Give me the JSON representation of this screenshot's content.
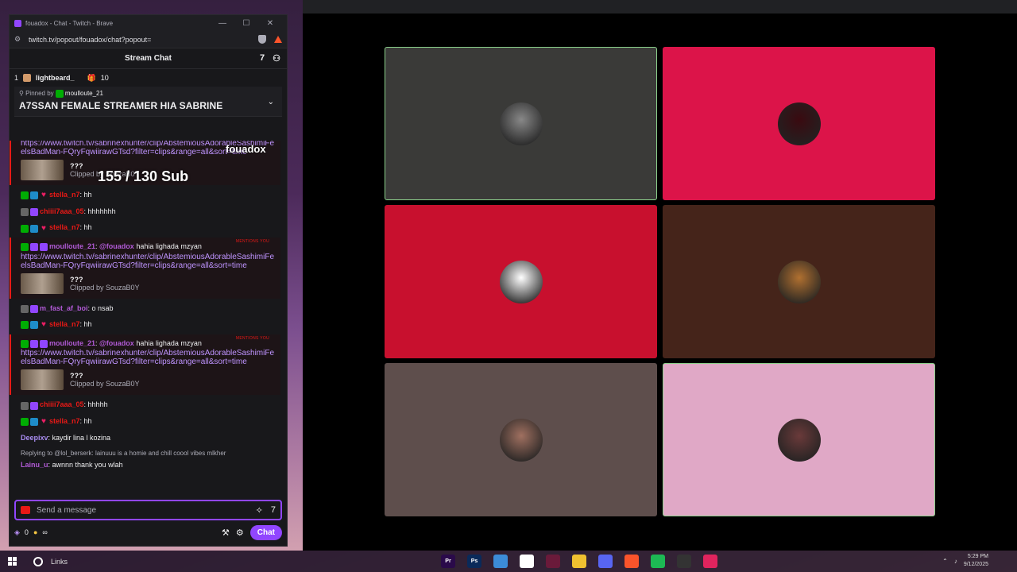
{
  "browser": {
    "title": "fouadox - Chat - Twitch - Brave",
    "url": "twitch.tv/popout/fouadox/chat?popout=",
    "controls": {
      "minimize": "—",
      "maximize": "☐",
      "close": "✕"
    }
  },
  "chat": {
    "header_title": "Stream Chat",
    "leaderboard": {
      "rank": "1",
      "user": "lightbeard_",
      "gift_count": "10"
    },
    "pinned": {
      "by_label": "Pinned by",
      "by_user": "moulloute_21",
      "message": "A7SSAN FEMALE STREAMER HIA SABRINE"
    },
    "clip_url": "https://www.twitch.tv/sabrinexhunter/clip/AbstemiousAdorableSashimiFeelsBadMan-FQryFqwiirawGTsd?filter=clips&range=all&sort=time",
    "clip_title": "???",
    "clip_by": "Clipped by SouzaB0Y",
    "mentions_tag": "MENTIONS YOU",
    "messages": [
      {
        "user": "stella_n7",
        "text": ": hh",
        "color": "#e91916"
      },
      {
        "user": "chiiii7aaa_05",
        "text": ": hhhhhhh",
        "color": "#e91916"
      },
      {
        "user": "stella_n7",
        "text": ": hh",
        "color": "#e91916"
      },
      {
        "user": "moulloute_21",
        "mention": "@fouadox",
        "text": "hahia lighada mzyan",
        "color": "#b15ad6"
      },
      {
        "user": "m_fast_af_boi",
        "text": ": o nsab",
        "color": "#b15ad6"
      },
      {
        "user": "stella_n7",
        "text": ": hh",
        "color": "#e91916"
      },
      {
        "user": "moulloute_21",
        "mention": "@fouadox",
        "text": "hahia lighada mzyan",
        "color": "#b15ad6"
      },
      {
        "user": "chiiii7aaa_05",
        "text": ": hhhhh",
        "color": "#e91916"
      },
      {
        "user": "stella_n7",
        "text": ": hh",
        "color": "#e91916"
      },
      {
        "user": "Deepixv",
        "text": ": kaydir lina l kozina",
        "color": "#a88cf0"
      },
      {
        "reply": "Replying to @lol_berserk: lainuuu is a homie and chill coool vibes mlkher",
        "user": "Lainu_u",
        "text": ": awnnn thank you wlah",
        "color": "#b15ad6"
      }
    ],
    "composer_placeholder": "Send a message",
    "points": "0",
    "infinity": "∞",
    "chat_button": "Chat"
  },
  "overlay": {
    "channel": "fouadox",
    "sub_goal": "155 / 130 Sub"
  },
  "call_tiles": [
    {
      "bg": "#3a3a38",
      "avatar": "#888888",
      "highlight": true
    },
    {
      "bg": "#dc1449",
      "avatar": "#3a0a10",
      "highlight": false
    },
    {
      "bg": "#c8102e",
      "avatar": "#ffffff",
      "highlight": false
    },
    {
      "bg": "#45241a",
      "avatar": "#b07030",
      "highlight": false
    },
    {
      "bg": "#5e4e4c",
      "avatar": "#a07060",
      "highlight": false
    },
    {
      "bg": "#e0a8c6",
      "avatar": "#6a3a3a",
      "highlight": true
    }
  ],
  "taskbar": {
    "search_label": "Links",
    "apps": [
      "Pr",
      "Ps",
      "",
      "",
      "",
      "",
      "",
      "",
      "",
      "",
      ""
    ],
    "time": "5:29 PM",
    "date": "9/12/2025"
  }
}
